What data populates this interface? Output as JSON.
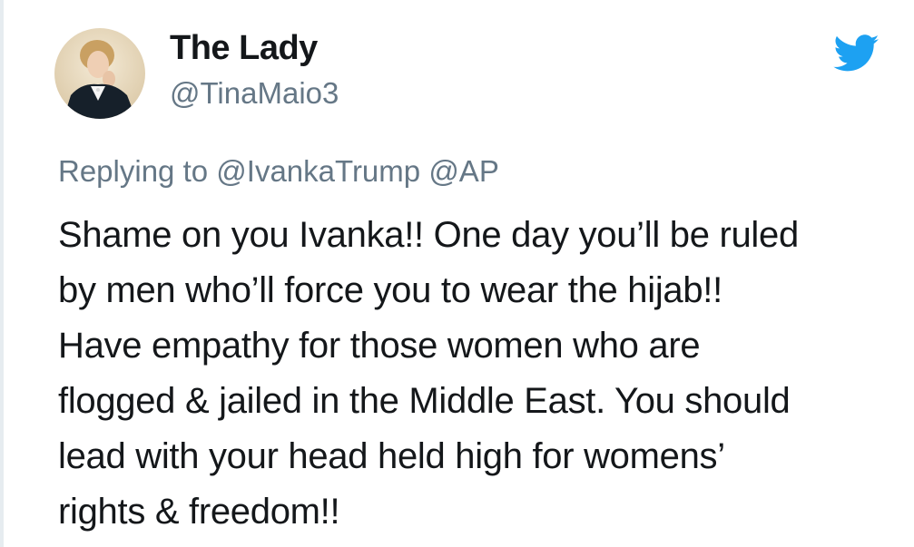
{
  "author": {
    "display_name": "The Lady",
    "handle": "@TinaMaio3",
    "avatar_icon": "profile-photo"
  },
  "platform_icon": "twitter-bird-icon",
  "colors": {
    "brand_blue": "#1da1f2",
    "text_primary": "#14171a",
    "text_secondary": "#657786"
  },
  "reply": {
    "prefix": "Replying to",
    "mentions": [
      "@IvankaTrump",
      "@AP"
    ]
  },
  "tweet_lines": [
    "Shame on you Ivanka!! One day you’ll be ruled",
    "by men who’ll force you to wear the hijab!!",
    "Have empathy for those women who are",
    "flogged & jailed in the Middle East. You should",
    "lead with your head held high for womens’",
    "rights & freedom!!"
  ]
}
